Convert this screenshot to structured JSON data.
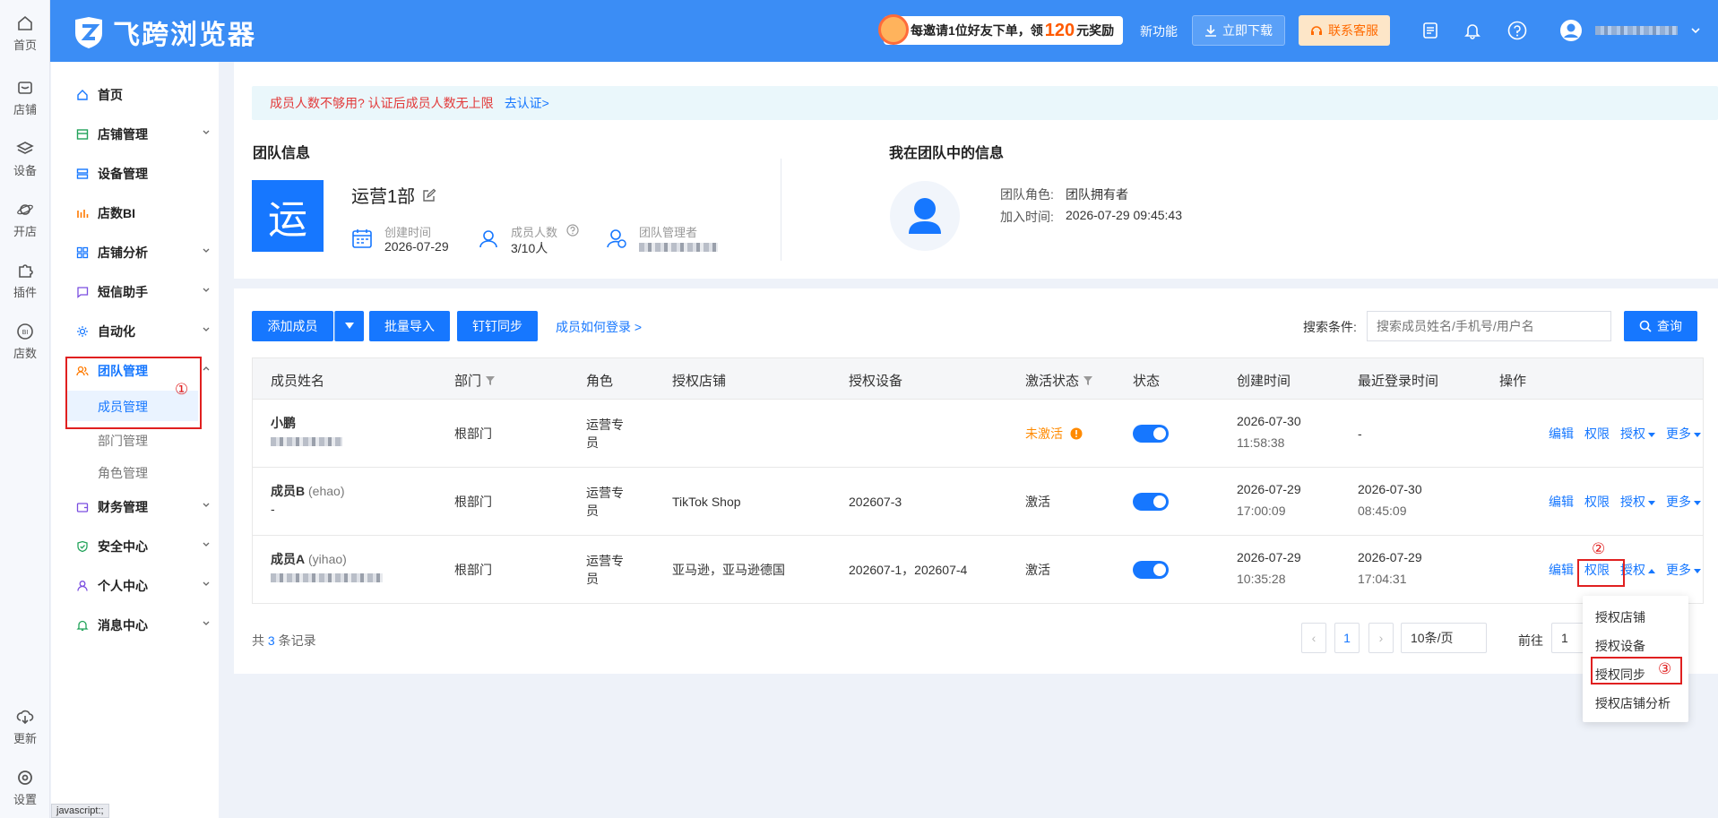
{
  "rail": [
    {
      "label": "首页",
      "icon": "home-icon"
    },
    {
      "label": "店铺",
      "icon": "shop-icon"
    },
    {
      "label": "设备",
      "icon": "layers-icon"
    },
    {
      "label": "开店",
      "icon": "planet-icon"
    },
    {
      "label": "插件",
      "icon": "puzzle-icon"
    },
    {
      "label": "店数",
      "icon": "bi-icon"
    },
    {
      "label": "更新",
      "icon": "cloud-download-icon"
    },
    {
      "label": "设置",
      "icon": "settings-icon"
    }
  ],
  "topbar": {
    "brand": "飞跨浏览器",
    "promo_prefix": "每邀请1位好友下单，领",
    "promo_amount": "120",
    "promo_suffix": "元奖励",
    "new_feature": "新功能",
    "download": "立即下载",
    "contact": "联系客服"
  },
  "sidebar": {
    "items": [
      {
        "label": "首页"
      },
      {
        "label": "店铺管理"
      },
      {
        "label": "设备管理"
      },
      {
        "label": "店数BI"
      },
      {
        "label": "店铺分析"
      },
      {
        "label": "短信助手"
      },
      {
        "label": "自动化"
      },
      {
        "label": "团队管理"
      },
      {
        "label": "财务管理"
      },
      {
        "label": "安全中心"
      },
      {
        "label": "个人中心"
      },
      {
        "label": "消息中心"
      }
    ],
    "team_sub": [
      "成员管理",
      "部门管理",
      "角色管理"
    ],
    "annotation": "①",
    "status_url": "javascript:;"
  },
  "notice": {
    "text": "成员人数不够用? 认证后成员人数无上限",
    "link": "去认证>"
  },
  "team_info": {
    "heading": "团队信息",
    "avatar_char": "运",
    "name": "运营1部",
    "created_label": "创建时间",
    "created_value": "2026-07-29",
    "members_label": "成员人数",
    "members_value": "3/10人",
    "manager_label": "团队管理者"
  },
  "my_info": {
    "heading": "我在团队中的信息",
    "role_label": "团队角色:",
    "role_value": "团队拥有者",
    "join_label": "加入时间:",
    "join_value": "2026-07-29 09:45:43"
  },
  "toolbar": {
    "add_member": "添加成员",
    "batch_import": "批量导入",
    "dingtalk_sync": "钉钉同步",
    "how_login": "成员如何登录 >",
    "search_label": "搜索条件:",
    "search_placeholder": "搜索成员姓名/手机号/用户名",
    "query": "查询"
  },
  "table": {
    "headers": [
      "成员姓名",
      "部门",
      "角色",
      "授权店铺",
      "授权设备",
      "激活状态",
      "状态",
      "创建时间",
      "最近登录时间",
      "操作"
    ],
    "rows": [
      {
        "name": "小鹏",
        "username": "",
        "dept": "根部门",
        "role1": "运营专",
        "role2": "员",
        "shops": "",
        "devices": "",
        "activation": "未激活",
        "created_date": "2026-07-30",
        "created_time": "11:58:38",
        "login_date": "-",
        "login_time": ""
      },
      {
        "name": "成员B",
        "username": "(ehao)",
        "sub": "-",
        "dept": "根部门",
        "role1": "运营专",
        "role2": "员",
        "shops": "TikTok Shop",
        "devices": "202607-3",
        "activation": "激活",
        "created_date": "2026-07-29",
        "created_time": "17:00:09",
        "login_date": "2026-07-30",
        "login_time": "08:45:09"
      },
      {
        "name": "成员A",
        "username": "(yihao)",
        "dept": "根部门",
        "role1": "运营专",
        "role2": "员",
        "shops": "亚马逊，亚马逊德国",
        "devices": "202607-1，202607-4",
        "activation": "激活",
        "created_date": "2026-07-29",
        "created_time": "10:35:28",
        "login_date": "2026-07-29",
        "login_time": "17:04:31"
      }
    ],
    "ops": {
      "edit": "编辑",
      "perm": "权限",
      "auth": "授权",
      "more": "更多"
    }
  },
  "dropdown": {
    "items": [
      "授权店铺",
      "授权设备",
      "授权同步",
      "授权店铺分析"
    ],
    "badge2": "②",
    "badge3": "③"
  },
  "pagination": {
    "total_prefix": "共",
    "total": "3",
    "total_suffix": "条记录",
    "page": "1",
    "page_size": "10条/页",
    "goto": "前往",
    "goto_value": "1"
  }
}
